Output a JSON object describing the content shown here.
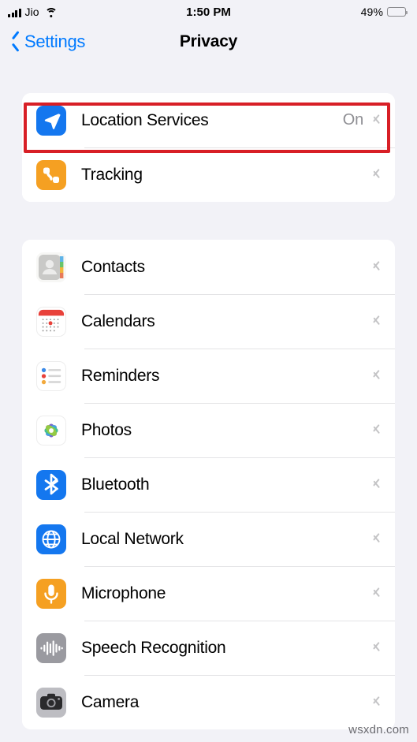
{
  "status_bar": {
    "carrier": "Jio",
    "signal_icon": "signal-bars-icon",
    "wifi_icon": "wifi-icon",
    "time": "1:50 PM",
    "battery_percent": "49%",
    "battery_level": 49,
    "battery_icon": "battery-icon"
  },
  "nav": {
    "back_icon": "chevron-left-icon",
    "back_label": "Settings",
    "title": "Privacy"
  },
  "groups": [
    {
      "rows": [
        {
          "icon": "location-services-icon",
          "label": "Location Services",
          "value": "On",
          "chevron": "chevron-right-icon",
          "highlighted": true
        },
        {
          "icon": "tracking-icon",
          "label": "Tracking",
          "value": "",
          "chevron": "chevron-right-icon",
          "highlighted": false
        }
      ]
    },
    {
      "rows": [
        {
          "icon": "contacts-icon",
          "label": "Contacts",
          "value": "",
          "chevron": "chevron-right-icon",
          "highlighted": false
        },
        {
          "icon": "calendars-icon",
          "label": "Calendars",
          "value": "",
          "chevron": "chevron-right-icon",
          "highlighted": false
        },
        {
          "icon": "reminders-icon",
          "label": "Reminders",
          "value": "",
          "chevron": "chevron-right-icon",
          "highlighted": false
        },
        {
          "icon": "photos-icon",
          "label": "Photos",
          "value": "",
          "chevron": "chevron-right-icon",
          "highlighted": false
        },
        {
          "icon": "bluetooth-icon",
          "label": "Bluetooth",
          "value": "",
          "chevron": "chevron-right-icon",
          "highlighted": false
        },
        {
          "icon": "local-network-icon",
          "label": "Local Network",
          "value": "",
          "chevron": "chevron-right-icon",
          "highlighted": false
        },
        {
          "icon": "microphone-icon",
          "label": "Microphone",
          "value": "",
          "chevron": "chevron-right-icon",
          "highlighted": false
        },
        {
          "icon": "speech-recognition-icon",
          "label": "Speech Recognition",
          "value": "",
          "chevron": "chevron-right-icon",
          "highlighted": false
        },
        {
          "icon": "camera-icon",
          "label": "Camera",
          "value": "",
          "chevron": "chevron-right-icon",
          "highlighted": false
        }
      ]
    }
  ],
  "annotation": {
    "color": "#d81f26",
    "target": "Location Services"
  },
  "watermark": "wsxdn.com",
  "colors": {
    "background": "#f2f2f7",
    "card": "#ffffff",
    "tint": "#007aff",
    "secondary_text": "#8e8e93",
    "separator": "#e4e4e6"
  }
}
